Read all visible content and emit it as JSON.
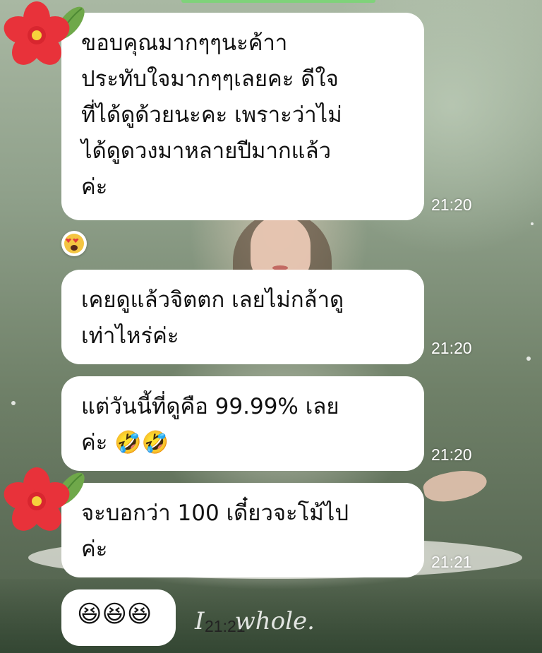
{
  "messages": [
    {
      "text": "ขอบคุณมากๆๆนะค้าา\nประทับใจมากๆๆเลยคะ ดีใจ\nที่ได้ดูด้วยนะคะ เพราะว่าไม่\nได้ดูดวงมาหลายปีมากแล้ว\nค่ะ",
      "time": "21:20",
      "has_avatar": true
    },
    {
      "text": "เคยดูแล้วจิตตก เลยไม่กล้าดู\nเท่าไหร่ค่ะ",
      "time": "21:20",
      "has_avatar": false
    },
    {
      "text": "แต่วันนี้ที่ดูคือ 99.99% เลย\nค่ะ 🤣🤣",
      "time": "21:20",
      "has_avatar": false
    },
    {
      "text": "จะบอกว่า 100 เดี๋ยวจะโม้ไป\nค่ะ",
      "time": "21:21",
      "has_avatar": true
    },
    {
      "text": "😆😆😆",
      "time": "21:21",
      "has_avatar": false
    }
  ],
  "reaction": {
    "icon": "heart-eyes-emoji-icon"
  },
  "avatar": {
    "icon": "red-hibiscus-flower-icon"
  },
  "background": {
    "watermark": "I    whole."
  },
  "colors": {
    "bubble": "#ffffff",
    "time": "#ffffff",
    "flower": "#e8323a",
    "flower_center": "#f6d23c",
    "leaf": "#6fa84a"
  }
}
